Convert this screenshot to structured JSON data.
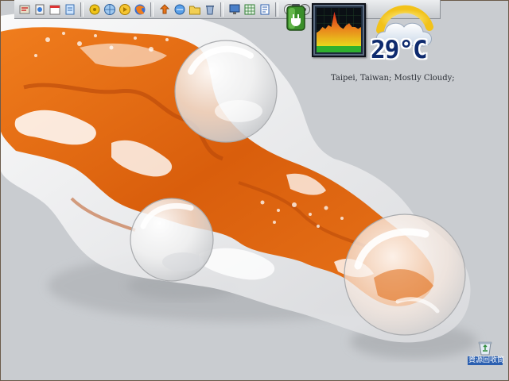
{
  "desktop": {
    "wallpaper_description": "",
    "colors": {
      "background": "#c9ccd0",
      "liquid_orange": "#e06a12",
      "glass": "#f3f3f3"
    }
  },
  "quicklaunch": {
    "groups": [
      [
        "generic-app-icon",
        "app-icon",
        "calendar-icon",
        "notes-icon"
      ],
      [
        "settings-icon",
        "globe-icon",
        "media-icon",
        "firefox-icon"
      ],
      [
        "transfer-icon",
        "network-icon",
        "folder-icon",
        "recycle-icon"
      ],
      [
        "monitor-icon",
        "spreadsheet-icon",
        "document-icon"
      ],
      [
        "clock-icon",
        "disk-icon"
      ]
    ]
  },
  "widgets": {
    "battery": {
      "icon": "battery-icon",
      "level": 0.75
    },
    "cpu_meter": {
      "icon": "cpu-meter",
      "history": [
        0.35,
        0.4,
        0.5,
        0.45,
        0.55,
        0.5,
        0.9,
        0.6,
        0.5,
        0.45,
        0.55,
        0.6,
        0.5,
        0.5,
        0.45,
        0.5
      ]
    },
    "weather": {
      "temperature": "29°C",
      "location_text": "Taipei, Taiwan; Mostly Cloudy;",
      "icon": "partly-cloudy-icon"
    }
  },
  "recycle_bin": {
    "label": "資源回收筒",
    "icon": "recycle-bin-icon"
  }
}
